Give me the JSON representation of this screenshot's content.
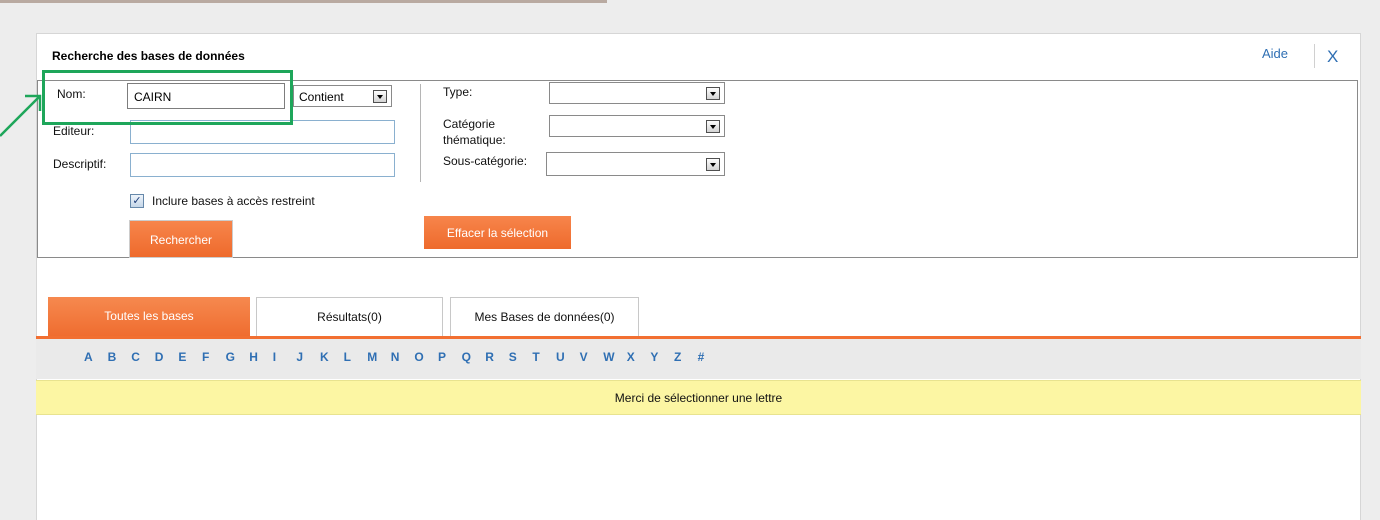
{
  "dialog": {
    "title": "Recherche des bases de données",
    "help": "Aide",
    "close": "X"
  },
  "form": {
    "nom_label": "Nom:",
    "nom_value": "CAIRN",
    "match_value": "Contient",
    "editeur_label": "Editeur:",
    "editeur_value": "",
    "descriptif_label": "Descriptif:",
    "descriptif_value": "",
    "type_label": "Type:",
    "categorie_label_1": "Catégorie",
    "categorie_label_2": "thématique:",
    "souscat_label": "Sous-catégorie:",
    "type_value": "",
    "categorie_value": "",
    "souscat_value": "",
    "checkbox_label": "Inclure bases à accès restreint",
    "checkbox_mark": "✓",
    "search_button": "Rechercher",
    "clear_button": "Effacer la sélection"
  },
  "tabs": [
    {
      "label": "Toutes les bases",
      "active": true
    },
    {
      "label": "Résultats(0)",
      "active": false
    },
    {
      "label": "Mes Bases de données(0)",
      "active": false
    }
  ],
  "alphabet": [
    "A",
    "B",
    "C",
    "D",
    "E",
    "F",
    "G",
    "H",
    "I",
    "J",
    "K",
    "L",
    "M",
    "N",
    "O",
    "P",
    "Q",
    "R",
    "S",
    "T",
    "U",
    "V",
    "W",
    "X",
    "Y",
    "Z",
    "#"
  ],
  "notice": "Merci de sélectionner une lettre",
  "colors": {
    "accent": "#f26f31",
    "link": "#2f6fb3",
    "highlight": "#1ea65a",
    "notice_bg": "#fcf6a3"
  }
}
